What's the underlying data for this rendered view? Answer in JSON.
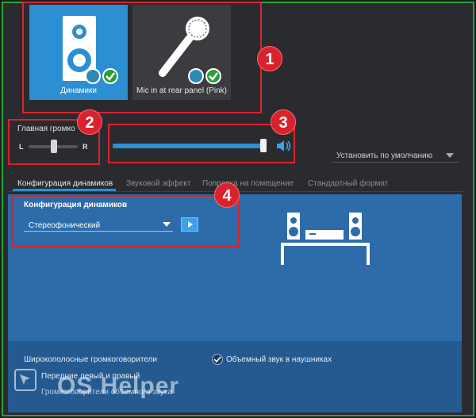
{
  "devices": {
    "speakers": {
      "label": "Динамики"
    },
    "mic": {
      "label": "Mic in at rear panel (Pink)"
    }
  },
  "volume": {
    "main_label": "Главная громко",
    "left": "L",
    "right": "R",
    "balance": 0.55,
    "master_level": 0.98
  },
  "default_button": {
    "label": "Установить по умолчанию"
  },
  "tabs": [
    {
      "label": "Конфигурация динамиков",
      "active": true
    },
    {
      "label": "Звуковой эффект",
      "active": false
    },
    {
      "label": "Поправка на помещение",
      "active": false
    },
    {
      "label": "Стандартный формат",
      "active": false
    }
  ],
  "config": {
    "title": "Конфигурация динамиков",
    "selected": "Стереофонический"
  },
  "bottom": {
    "wideband": "Широкополосные громкоговорители",
    "front": "Передние левый и правый",
    "surround_speakers": "Громкоговорители объемного звука",
    "headphones_surround": "Объемный звук в наушниках"
  },
  "callouts": [
    "1",
    "2",
    "3",
    "4"
  ],
  "watermark": "OS Helper",
  "colors": {
    "accent": "#2c8fd1",
    "callout": "#d8232f",
    "frame": "#24a335"
  }
}
